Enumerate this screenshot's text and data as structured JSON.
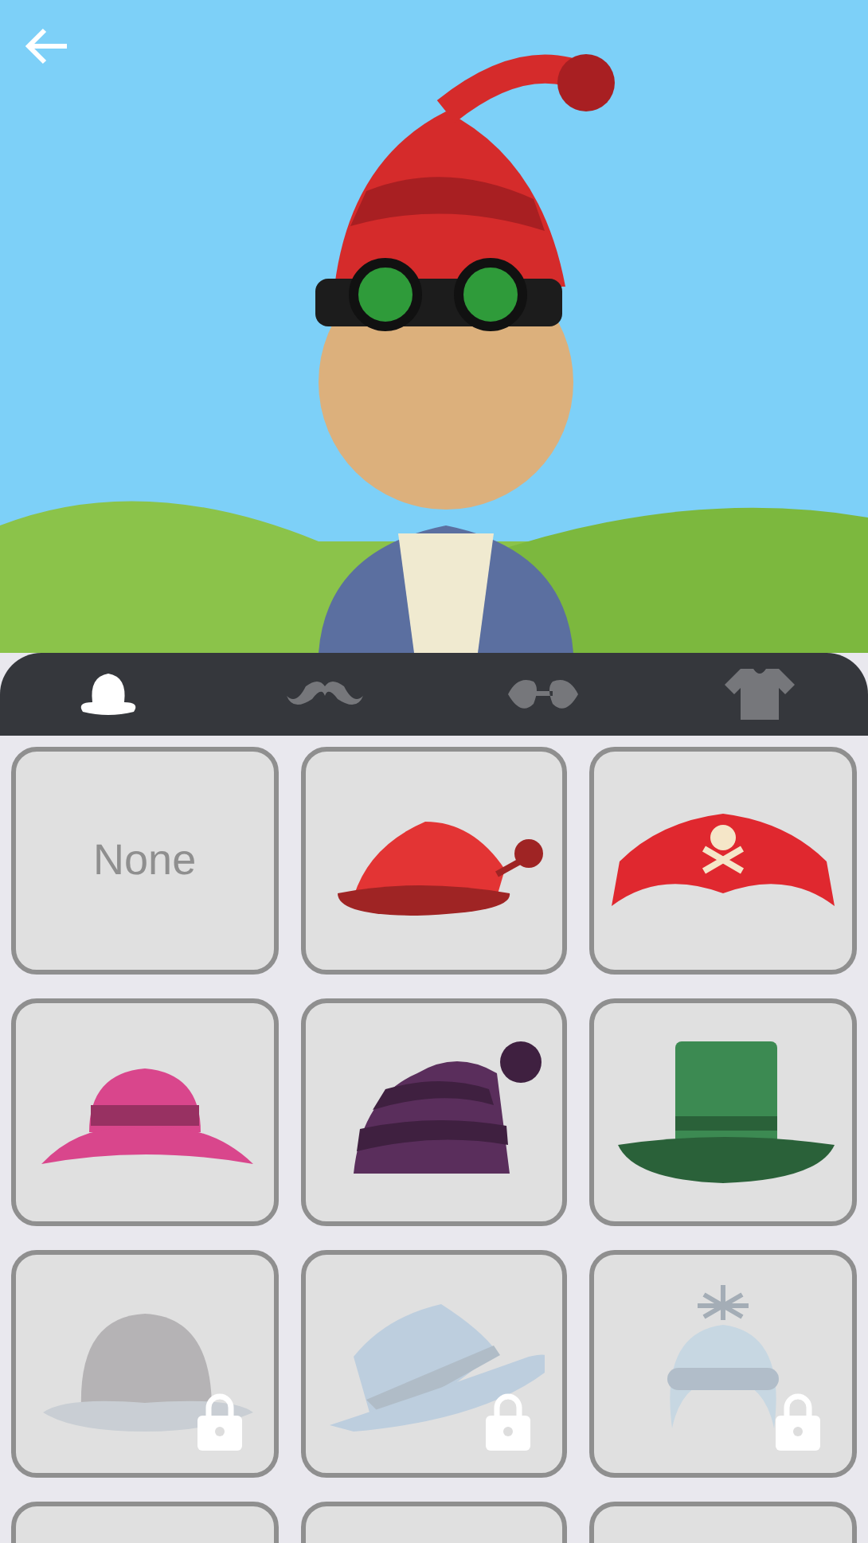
{
  "tabs": [
    {
      "kind": "hat",
      "selected": true
    },
    {
      "kind": "mustache",
      "selected": false
    },
    {
      "kind": "glasses",
      "selected": false
    },
    {
      "kind": "shirt",
      "selected": false
    }
  ],
  "items": [
    {
      "kind": "none",
      "label": "None",
      "locked": false
    },
    {
      "kind": "beanie",
      "color": "#e33434",
      "locked": false
    },
    {
      "kind": "pirate",
      "color": "#e0282f",
      "locked": false
    },
    {
      "kind": "bucket",
      "color": "#d9468c",
      "locked": false
    },
    {
      "kind": "wizard",
      "color": "#5a2e5c",
      "locked": false
    },
    {
      "kind": "tophat",
      "color": "#3c8a52",
      "locked": false
    },
    {
      "kind": "cap",
      "color": "#aeacae",
      "locked": true
    },
    {
      "kind": "fedora",
      "color": "#b7cbde",
      "locked": true
    },
    {
      "kind": "winter",
      "color": "#c3d6e3",
      "locked": true
    },
    {
      "kind": "empty"
    },
    {
      "kind": "empty"
    },
    {
      "kind": "empty"
    }
  ]
}
